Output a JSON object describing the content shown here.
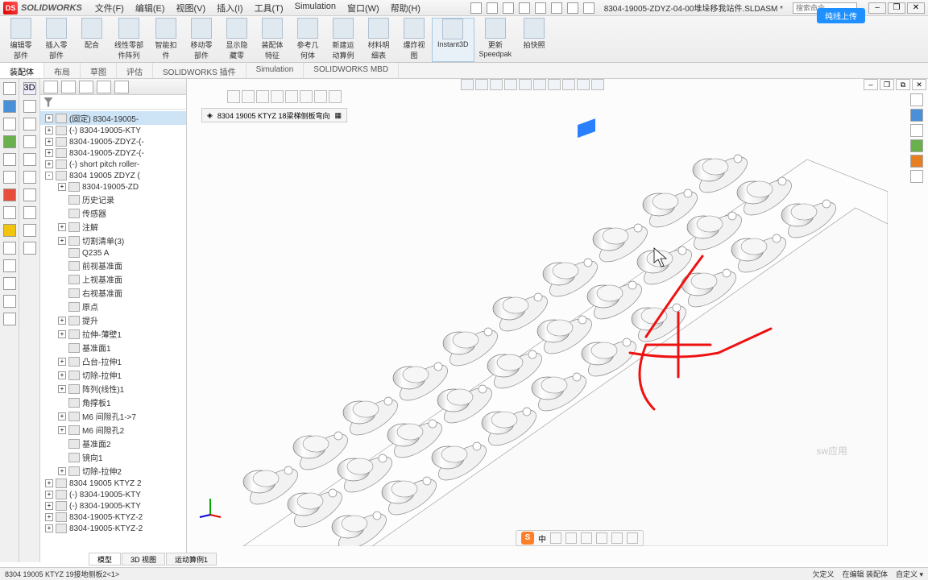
{
  "title": {
    "brand": "SOLIDWORKS",
    "menus": [
      "文件(F)",
      "编辑(E)",
      "视图(V)",
      "插入(I)",
      "工具(T)",
      "Simulation",
      "窗口(W)",
      "帮助(H)"
    ],
    "doc": "8304-19005-ZDYZ-04-00堆垛移我站件.SLDASM *",
    "search_placeholder": "搜索命令"
  },
  "upload": "纯线上传",
  "ribbon": [
    {
      "l1": "编辑零",
      "l2": "部件"
    },
    {
      "l1": "插入零",
      "l2": "部件"
    },
    {
      "l1": "配合",
      "l2": ""
    },
    {
      "l1": "线性零部",
      "l2": "件阵列"
    },
    {
      "l1": "智能扣",
      "l2": "件"
    },
    {
      "l1": "移动零",
      "l2": "部件"
    },
    {
      "l1": "显示隐",
      "l2": "藏零"
    },
    {
      "l1": "装配体",
      "l2": "特征"
    },
    {
      "l1": "参考几",
      "l2": "何体"
    },
    {
      "l1": "新建运",
      "l2": "动算例"
    },
    {
      "l1": "材料明",
      "l2": "细表"
    },
    {
      "l1": "爆炸视",
      "l2": "图"
    },
    {
      "l1": "Instant3D",
      "l2": "",
      "active": true
    },
    {
      "l1": "更新",
      "l2": "Speedpak"
    },
    {
      "l1": "拍快照",
      "l2": ""
    }
  ],
  "tabs": [
    "装配体",
    "布局",
    "草图",
    "评估",
    "SOLIDWORKS 插件",
    "Simulation",
    "SOLIDWORKS MBD"
  ],
  "active_tab": 0,
  "tree": [
    {
      "lvl": 1,
      "exp": "+",
      "txt": "(固定) 8304-19005-",
      "sel": true
    },
    {
      "lvl": 1,
      "exp": "+",
      "txt": "(-) 8304-19005-KTY"
    },
    {
      "lvl": 1,
      "exp": "+",
      "txt": "8304-19005-ZDYZ-(-"
    },
    {
      "lvl": 1,
      "exp": "+",
      "txt": "8304-19005-ZDYZ-(-"
    },
    {
      "lvl": 1,
      "exp": "+",
      "txt": "(-) short pitch roller-"
    },
    {
      "lvl": 1,
      "exp": "-",
      "txt": "8304 19005 ZDYZ ("
    },
    {
      "lvl": 2,
      "exp": "+",
      "txt": "8304-19005-ZD"
    },
    {
      "lvl": 2,
      "exp": "",
      "txt": "历史记录"
    },
    {
      "lvl": 2,
      "exp": "",
      "txt": "传感器"
    },
    {
      "lvl": 2,
      "exp": "+",
      "txt": "注解"
    },
    {
      "lvl": 2,
      "exp": "+",
      "txt": "切割清单(3)"
    },
    {
      "lvl": 2,
      "exp": "",
      "txt": "Q235 A"
    },
    {
      "lvl": 2,
      "exp": "",
      "txt": "前视基准面"
    },
    {
      "lvl": 2,
      "exp": "",
      "txt": "上视基准面"
    },
    {
      "lvl": 2,
      "exp": "",
      "txt": "右视基准面"
    },
    {
      "lvl": 2,
      "exp": "",
      "txt": "原点"
    },
    {
      "lvl": 2,
      "exp": "+",
      "txt": "提升"
    },
    {
      "lvl": 2,
      "exp": "+",
      "txt": "拉伸-薄壁1"
    },
    {
      "lvl": 2,
      "exp": "",
      "txt": "基准面1"
    },
    {
      "lvl": 2,
      "exp": "+",
      "txt": "凸台-拉伸1"
    },
    {
      "lvl": 2,
      "exp": "+",
      "txt": "切除-拉伸1"
    },
    {
      "lvl": 2,
      "exp": "+",
      "txt": "阵列(线性)1"
    },
    {
      "lvl": 2,
      "exp": "",
      "txt": "角撑板1"
    },
    {
      "lvl": 2,
      "exp": "+",
      "txt": "M6 间隙孔1->7"
    },
    {
      "lvl": 2,
      "exp": "+",
      "txt": "M6 间隙孔2"
    },
    {
      "lvl": 2,
      "exp": "",
      "txt": "基准面2"
    },
    {
      "lvl": 2,
      "exp": "",
      "txt": "镜向1"
    },
    {
      "lvl": 2,
      "exp": "+",
      "txt": "切除-拉伸2"
    },
    {
      "lvl": 1,
      "exp": "+",
      "txt": "8304 19005 KTYZ 2"
    },
    {
      "lvl": 1,
      "exp": "+",
      "txt": "(-) 8304-19005-KTY"
    },
    {
      "lvl": 1,
      "exp": "+",
      "txt": "(-) 8304-19005-KTY"
    },
    {
      "lvl": 1,
      "exp": "+",
      "txt": "8304-19005-KTYZ-2"
    },
    {
      "lvl": 1,
      "exp": "+",
      "txt": "8304-19005-KTYZ-2"
    }
  ],
  "breadcrumb": [
    "8304 19005 KTYZ 18梁梯侧板弯向"
  ],
  "bottom_tabs": [
    "模型",
    "3D 视图",
    "运动算例1"
  ],
  "status": {
    "left": "8304 19005 KTYZ 19接地侧板2<1>",
    "right": [
      "欠定义",
      "在编辑 装配体",
      "自定义 ▾"
    ]
  },
  "ime": {
    "txt": "中"
  },
  "watermark": "sw应用"
}
